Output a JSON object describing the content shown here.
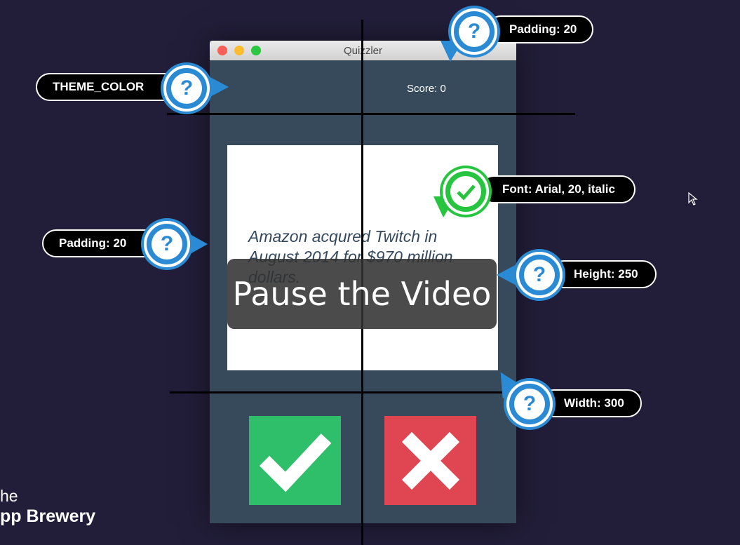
{
  "window": {
    "title": "Quizzler",
    "score_label": "Score: 0",
    "question_text": "Amazon acqured Twitch in August 2014 for $970 million dollars.",
    "true_button_icon": "check-icon",
    "false_button_icon": "x-icon",
    "colors": {
      "background": "#374a5c",
      "true": "#2fbf6a",
      "false": "#e04552",
      "card": "#ffffff"
    }
  },
  "annotations": {
    "padding_top": "Padding: 20",
    "theme_color": "THEME_COLOR",
    "font": "Font: Arial, 20, italic",
    "padding_left": "Padding: 20",
    "height": "Height: 250",
    "width": "Width: 300"
  },
  "overlay": {
    "pause_text": "Pause the Video"
  },
  "branding": {
    "line1": "he",
    "line2": "pp Brewery"
  },
  "colors": {
    "page_background": "#221e3a",
    "badge_blue": "#2a8bd4",
    "badge_green": "#27c53f"
  }
}
